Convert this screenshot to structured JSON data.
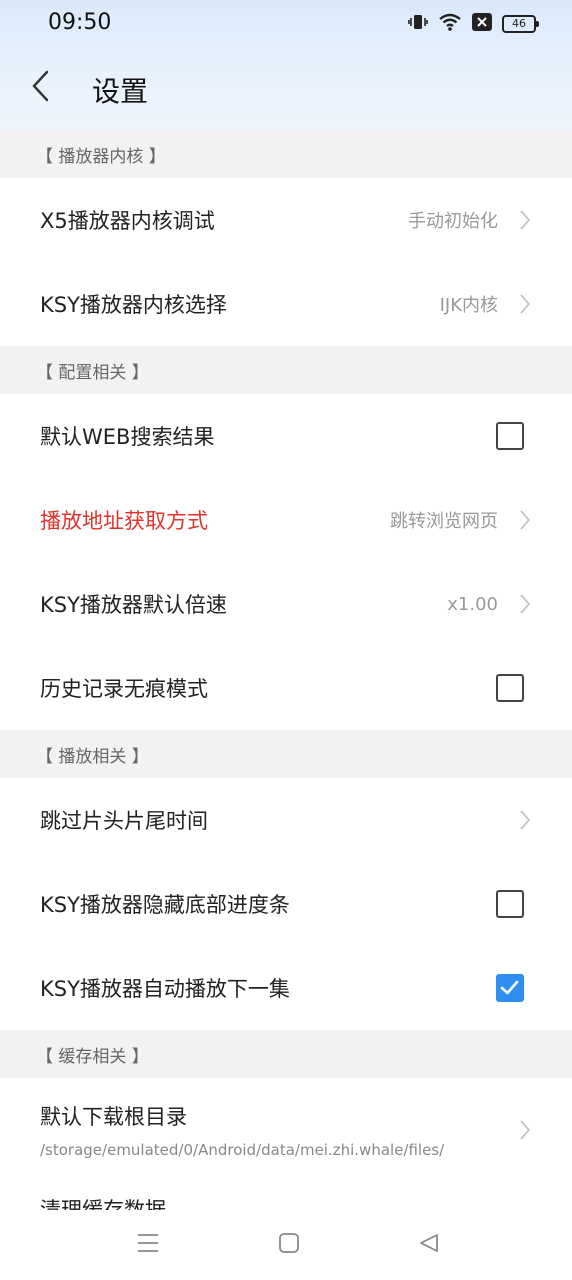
{
  "status_bar": {
    "time": "09:50",
    "battery": "46"
  },
  "header": {
    "title": "设置"
  },
  "sections": [
    {
      "title": "【 播放器内核 】",
      "rows": [
        {
          "label": "X5播放器内核调试",
          "type": "value",
          "value": "手动初始化"
        },
        {
          "label": "KSY播放器内核选择",
          "type": "value",
          "value": "IJK内核"
        }
      ]
    },
    {
      "title": "【 配置相关 】",
      "rows": [
        {
          "label": "默认WEB搜索结果",
          "type": "checkbox",
          "checked": false
        },
        {
          "label": "播放地址获取方式",
          "type": "value",
          "value": "跳转浏览网页",
          "highlight": "#e0332b"
        },
        {
          "label": "KSY播放器默认倍速",
          "type": "value",
          "value": "x1.00"
        },
        {
          "label": "历史记录无痕模式",
          "type": "checkbox",
          "checked": false
        }
      ]
    },
    {
      "title": "【 播放相关 】",
      "rows": [
        {
          "label": "跳过片头片尾时间",
          "type": "chevron"
        },
        {
          "label": "KSY播放器隐藏底部进度条",
          "type": "checkbox",
          "checked": false
        },
        {
          "label": "KSY播放器自动播放下一集",
          "type": "checkbox",
          "checked": true
        }
      ]
    },
    {
      "title": "【 缓存相关 】",
      "rows": [
        {
          "label": "默认下载根目录",
          "type": "path",
          "sub": "/storage/emulated/0/Android/data/mei.zhi.whale/files/"
        },
        {
          "label": "清理缓存数据",
          "type": "partial"
        }
      ]
    }
  ],
  "colors": {
    "accent": "#2f8ef2",
    "highlight": "#e0332b",
    "section_bg": "#f2f2f2"
  }
}
